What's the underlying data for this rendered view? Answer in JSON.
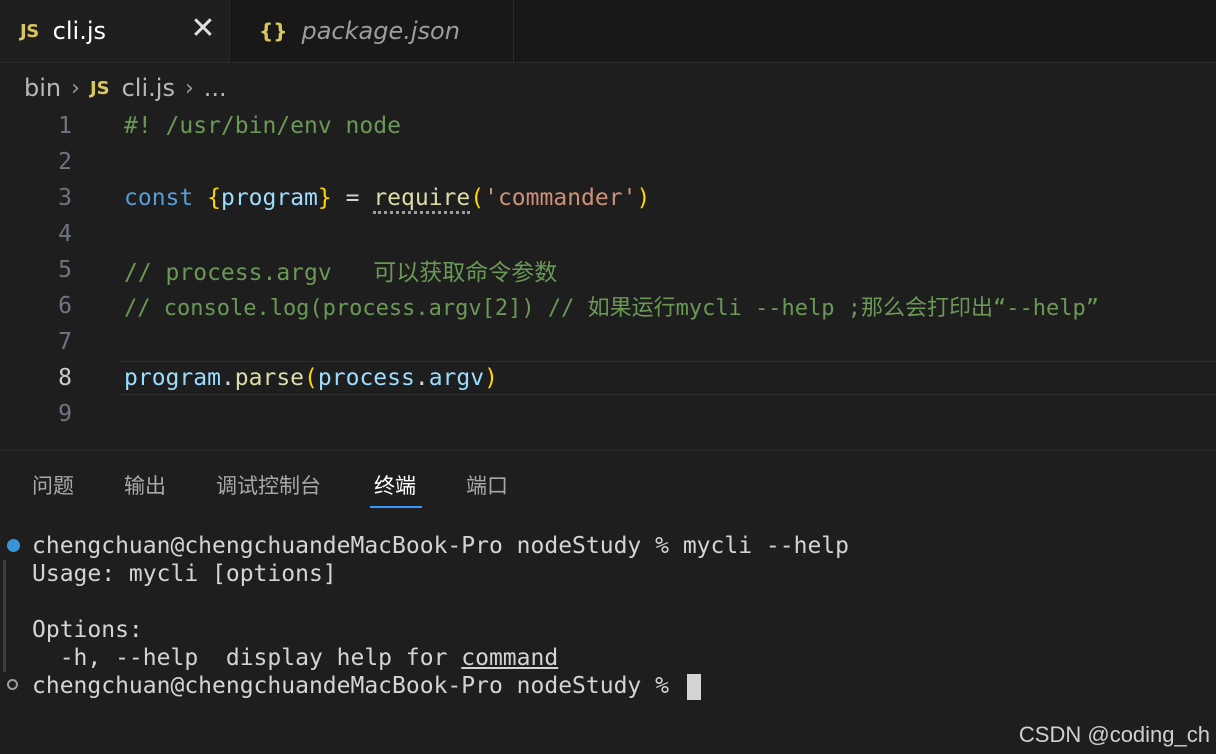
{
  "tabs": [
    {
      "icon": "JS",
      "label": "cli.js",
      "active": true,
      "close": "✕"
    },
    {
      "icon": "{}",
      "label": "package.json",
      "active": false
    }
  ],
  "breadcrumb": {
    "folder": "bin",
    "file_icon": "JS",
    "file": "cli.js",
    "rest": "..."
  },
  "editor": {
    "current_line": 8,
    "line_numbers": [
      "1",
      "2",
      "3",
      "4",
      "5",
      "6",
      "7",
      "8",
      "9"
    ],
    "lines": [
      {
        "n": "1",
        "text": "#! /usr/bin/env node"
      },
      {
        "n": "2",
        "text": ""
      },
      {
        "n": "3",
        "text": "const {program} = require('commander')"
      },
      {
        "n": "4",
        "text": ""
      },
      {
        "n": "5",
        "text": "// process.argv   可以获取命令参数"
      },
      {
        "n": "6",
        "text": "// console.log(process.argv[2]) // 如果运行mycli --help ;那么会打印出“--help”"
      },
      {
        "n": "7",
        "text": ""
      },
      {
        "n": "8",
        "text": "program.parse(process.argv)"
      },
      {
        "n": "9",
        "text": ""
      }
    ],
    "tokens": {
      "shebang": "#! /usr/bin/env node",
      "const": "const",
      "brace_open": "{",
      "program_var": "program",
      "brace_close": "}",
      "equals": " = ",
      "require": "require",
      "paren_open": "(",
      "commander_str": "'commander'",
      "paren_close": ")",
      "comment5": "// process.argv   可以获取命令参数",
      "comment6": "// console.log(process.argv[2]) // 如果运行mycli --help ;那么会打印出“--help”",
      "program2": "program",
      "dot": ".",
      "parse": "parse",
      "process": "process",
      "argv": "argv"
    }
  },
  "panel": {
    "tabs": [
      "问题",
      "输出",
      "调试控制台",
      "终端",
      "端口"
    ],
    "active_tab": "终端"
  },
  "terminal": {
    "line1": "chengchuan@chengchuandeMacBook-Pro nodeStudy % mycli --help",
    "line2": "Usage: mycli [options]",
    "line3": "",
    "line4": "Options:",
    "line5_prefix": "  -h, --help  display help for ",
    "line5_link": "command",
    "line6": "chengchuan@chengchuandeMacBook-Pro nodeStudy % "
  },
  "watermark": "CSDN @coding_ch",
  "colors": {
    "background": "#1e1e1e",
    "keyword": "#569cd6",
    "variable": "#9cdcfe",
    "function": "#dcdcaa",
    "string": "#ce9178",
    "comment": "#6a9955",
    "bracket": "#ffd700",
    "accent": "#3794ff"
  }
}
